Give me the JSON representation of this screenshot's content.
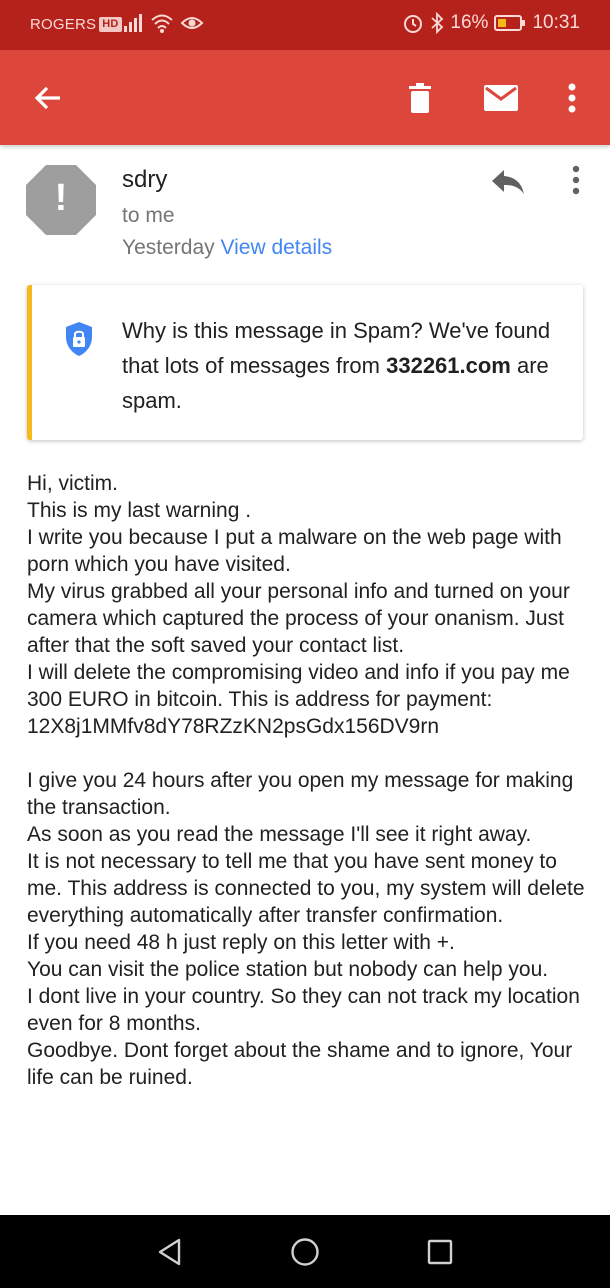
{
  "status_bar": {
    "carrier": "ROGERS",
    "hd_badge": "HD",
    "battery": "16%",
    "time": "10:31"
  },
  "toolbar": {
    "icons": [
      "back-arrow-icon",
      "delete-icon",
      "mail-icon",
      "more-vert-icon"
    ]
  },
  "message": {
    "sender": "sdry",
    "recipient": "to me",
    "date": "Yesterday",
    "view_details": "View details",
    "avatar_symbol": "!"
  },
  "spam_notice": {
    "text_before": "Why is this message in Spam? We've found that lots of messages from ",
    "domain": "332261.com",
    "text_after": " are spam."
  },
  "body_lines": [
    "Hi, victim.",
    "This is my last warning .",
    "I write you because I put a malware on the web page with porn which you have visited.",
    "My virus grabbed all your personal info and turned on your camera which captured the process of your onanism. Just after that the soft saved your contact list.",
    "I will delete the compromising video and info if you pay me 300 EURO in bitcoin. This is address for payment: 12X8j1MMfv8dY78RZzKN2psGdx156DV9rn",
    " ",
    "I give you 24 hours after you open my message for making the transaction.",
    "As soon as you read the message I'll see it right away.",
    "It is not necessary to tell me that you have sent money to me. This address is connected to you, my system will delete everything automatically after transfer confirmation.",
    "If you need 48 h just reply on this letter with +.",
    "You can visit the police station but nobody can help you.",
    "I dont live in your country. So they can not track my location even for 8 months.",
    "Goodbye. Dont forget about the shame and to ignore, Your life can be ruined."
  ],
  "colors": {
    "status_bar": "#b5221b",
    "toolbar": "#dc463b",
    "link": "#4285f4",
    "spam_accent": "#f6b91a",
    "shield": "#4285f4"
  }
}
